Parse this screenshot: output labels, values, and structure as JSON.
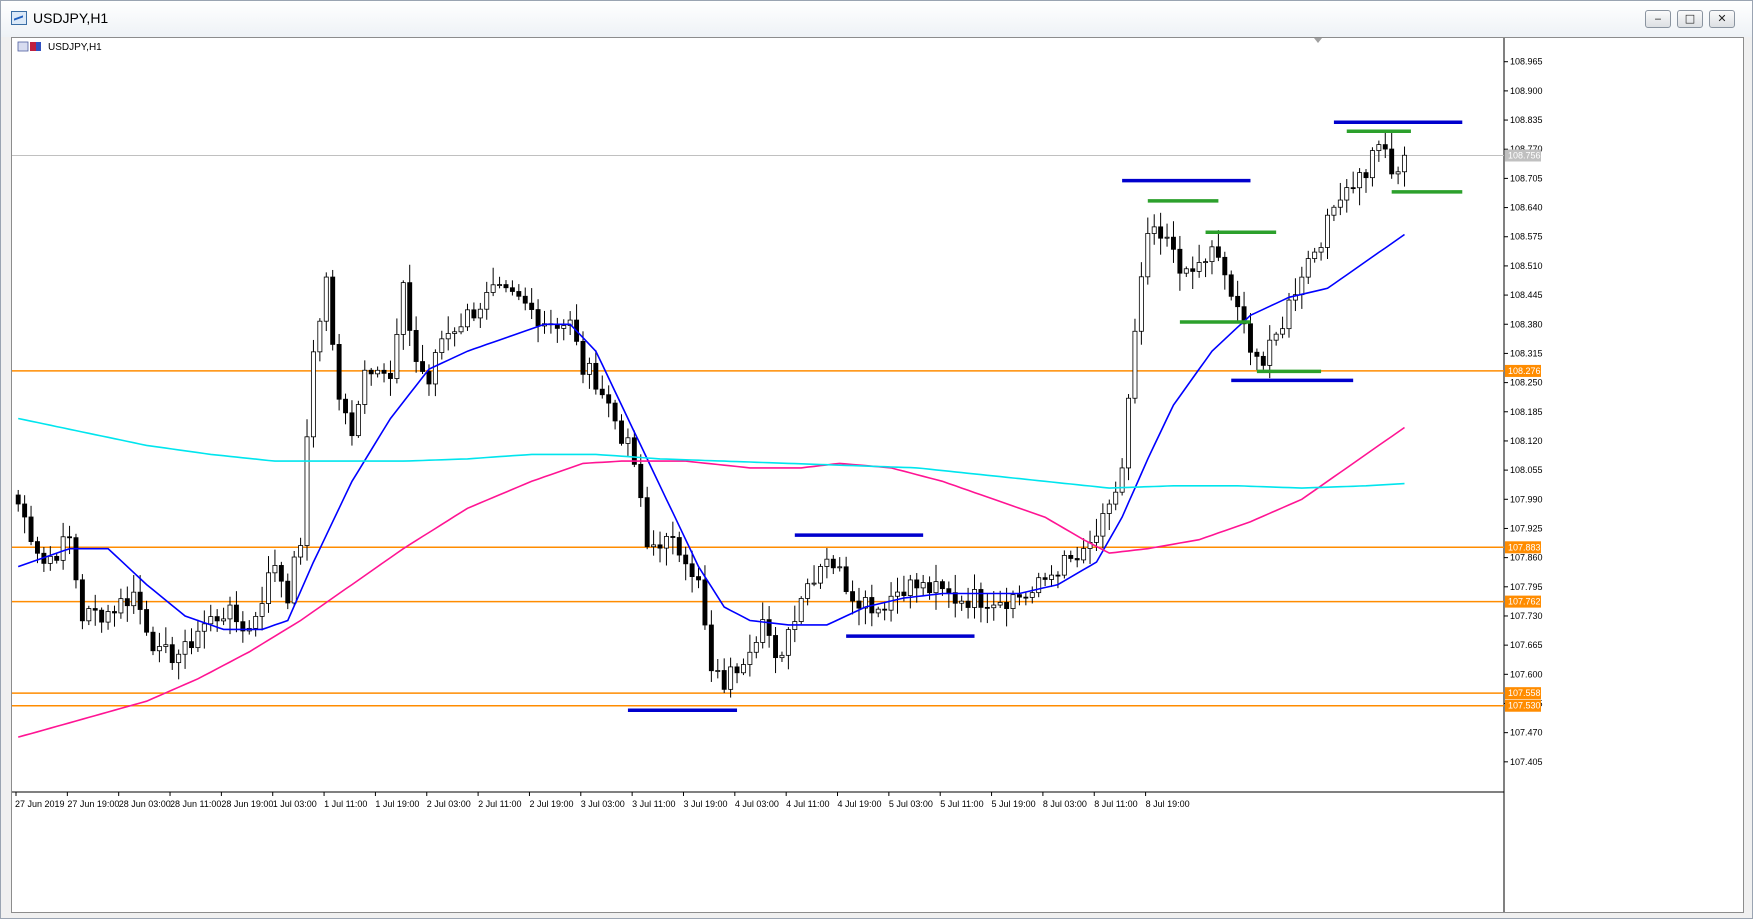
{
  "window": {
    "title": "USDJPY,H1",
    "min_label": "‒",
    "max_label": "□",
    "close_label": "✕"
  },
  "chart_label": "USDJPY,H1",
  "chart_data": {
    "type": "candlestick",
    "symbol": "USDJPY",
    "timeframe": "H1",
    "ylim": [
      107.34,
      109.0
    ],
    "y_ticks": [
      "108.965",
      "108.900",
      "108.835",
      "108.770",
      "108.705",
      "108.640",
      "108.575",
      "108.510",
      "108.445",
      "108.380",
      "108.315",
      "108.250",
      "108.185",
      "108.120",
      "108.055",
      "107.990",
      "107.925",
      "107.860",
      "107.795",
      "107.730",
      "107.665",
      "107.600",
      "107.535",
      "107.470",
      "107.405"
    ],
    "x_ticks": [
      "27 Jun 2019",
      "27 Jun 19:00",
      "28 Jun 03:00",
      "28 Jun 11:00",
      "28 Jun 19:00",
      "1 Jul 03:00",
      "1 Jul 11:00",
      "1 Jul 19:00",
      "2 Jul 03:00",
      "2 Jul 11:00",
      "2 Jul 19:00",
      "3 Jul 03:00",
      "3 Jul 11:00",
      "3 Jul 19:00",
      "4 Jul 03:00",
      "4 Jul 11:00",
      "4 Jul 19:00",
      "5 Jul 03:00",
      "5 Jul 11:00",
      "5 Jul 19:00",
      "8 Jul 03:00",
      "8 Jul 11:00",
      "8 Jul 19:00"
    ],
    "current_price": {
      "label": "108.756",
      "value": 108.756,
      "color": "#c0c0c0"
    },
    "horizontal_levels": [
      {
        "label": "108.276",
        "value": 108.276,
        "color": "#ff8c00"
      },
      {
        "label": "107.883",
        "value": 107.883,
        "color": "#ff8c00"
      },
      {
        "label": "107.762",
        "value": 107.762,
        "color": "#ff8c00"
      },
      {
        "label": "107.558",
        "value": 107.558,
        "color": "#ff8c00"
      },
      {
        "label": "107.530",
        "value": 107.53,
        "color": "#ff8c00"
      }
    ],
    "segments": [
      {
        "color": "#0000cd",
        "start_bar": 95,
        "end_bar": 112,
        "price": 107.52
      },
      {
        "color": "#0000cd",
        "start_bar": 121,
        "end_bar": 141,
        "price": 107.91
      },
      {
        "color": "#0000cd",
        "start_bar": 129,
        "end_bar": 149,
        "price": 107.685
      },
      {
        "color": "#0000cd",
        "start_bar": 172,
        "end_bar": 192,
        "price": 108.7
      },
      {
        "color": "#2ca02c",
        "start_bar": 176,
        "end_bar": 187,
        "price": 108.655
      },
      {
        "color": "#2ca02c",
        "start_bar": 185,
        "end_bar": 196,
        "price": 108.585
      },
      {
        "color": "#2ca02c",
        "start_bar": 181,
        "end_bar": 192,
        "price": 108.385
      },
      {
        "color": "#0000cd",
        "start_bar": 189,
        "end_bar": 208,
        "price": 108.255
      },
      {
        "color": "#2ca02c",
        "start_bar": 193,
        "end_bar": 203,
        "price": 108.275
      },
      {
        "color": "#0000cd",
        "start_bar": 205,
        "end_bar": 225,
        "price": 108.83
      },
      {
        "color": "#2ca02c",
        "start_bar": 207,
        "end_bar": 217,
        "price": 108.81
      },
      {
        "color": "#2ca02c",
        "start_bar": 214,
        "end_bar": 225,
        "price": 108.675
      }
    ],
    "moving_averages": [
      {
        "color": "#0000ff",
        "keys": [
          [
            0,
            107.84
          ],
          [
            8,
            107.88
          ],
          [
            14,
            107.88
          ],
          [
            20,
            107.8
          ],
          [
            26,
            107.73
          ],
          [
            32,
            107.7
          ],
          [
            38,
            107.7
          ],
          [
            42,
            107.72
          ],
          [
            46,
            107.85
          ],
          [
            52,
            108.03
          ],
          [
            58,
            108.17
          ],
          [
            64,
            108.28
          ],
          [
            70,
            108.32
          ],
          [
            76,
            108.35
          ],
          [
            82,
            108.38
          ],
          [
            86,
            108.38
          ],
          [
            90,
            108.32
          ],
          [
            94,
            108.2
          ],
          [
            98,
            108.08
          ],
          [
            102,
            107.96
          ],
          [
            106,
            107.84
          ],
          [
            110,
            107.75
          ],
          [
            114,
            107.72
          ],
          [
            120,
            107.71
          ],
          [
            126,
            107.71
          ],
          [
            132,
            107.75
          ],
          [
            138,
            107.77
          ],
          [
            144,
            107.78
          ],
          [
            150,
            107.78
          ],
          [
            156,
            107.78
          ],
          [
            162,
            107.8
          ],
          [
            168,
            107.85
          ],
          [
            172,
            107.95
          ],
          [
            176,
            108.08
          ],
          [
            180,
            108.2
          ],
          [
            186,
            108.32
          ],
          [
            192,
            108.4
          ],
          [
            198,
            108.44
          ],
          [
            204,
            108.46
          ],
          [
            210,
            108.52
          ],
          [
            216,
            108.58
          ]
        ]
      },
      {
        "color": "#ff1493",
        "keys": [
          [
            0,
            107.46
          ],
          [
            10,
            107.5
          ],
          [
            20,
            107.54
          ],
          [
            28,
            107.59
          ],
          [
            36,
            107.65
          ],
          [
            44,
            107.72
          ],
          [
            52,
            107.8
          ],
          [
            60,
            107.88
          ],
          [
            70,
            107.97
          ],
          [
            80,
            108.03
          ],
          [
            88,
            108.07
          ],
          [
            94,
            108.075
          ],
          [
            104,
            108.075
          ],
          [
            114,
            108.06
          ],
          [
            122,
            108.06
          ],
          [
            128,
            108.07
          ],
          [
            136,
            108.06
          ],
          [
            144,
            108.03
          ],
          [
            152,
            107.99
          ],
          [
            160,
            107.95
          ],
          [
            166,
            107.9
          ],
          [
            170,
            107.87
          ],
          [
            176,
            107.88
          ],
          [
            184,
            107.9
          ],
          [
            192,
            107.94
          ],
          [
            200,
            107.99
          ],
          [
            206,
            108.05
          ],
          [
            212,
            108.11
          ],
          [
            216,
            108.15
          ]
        ]
      },
      {
        "color": "#00e5ee",
        "keys": [
          [
            0,
            108.17
          ],
          [
            10,
            108.14
          ],
          [
            20,
            108.11
          ],
          [
            30,
            108.09
          ],
          [
            40,
            108.075
          ],
          [
            50,
            108.075
          ],
          [
            60,
            108.075
          ],
          [
            70,
            108.08
          ],
          [
            80,
            108.09
          ],
          [
            90,
            108.09
          ],
          [
            100,
            108.08
          ],
          [
            110,
            108.075
          ],
          [
            120,
            108.07
          ],
          [
            130,
            108.065
          ],
          [
            140,
            108.06
          ],
          [
            150,
            108.045
          ],
          [
            160,
            108.03
          ],
          [
            170,
            108.015
          ],
          [
            180,
            108.02
          ],
          [
            190,
            108.02
          ],
          [
            200,
            108.015
          ],
          [
            210,
            108.02
          ],
          [
            216,
            108.025
          ]
        ]
      }
    ],
    "price_anchors": [
      [
        0,
        107.98
      ],
      [
        4,
        107.85
      ],
      [
        8,
        107.9
      ],
      [
        10,
        107.73
      ],
      [
        14,
        107.74
      ],
      [
        18,
        107.78
      ],
      [
        22,
        107.64
      ],
      [
        26,
        107.65
      ],
      [
        28,
        107.7
      ],
      [
        32,
        107.74
      ],
      [
        36,
        107.7
      ],
      [
        40,
        107.85
      ],
      [
        42,
        107.78
      ],
      [
        44,
        107.9
      ],
      [
        46,
        108.32
      ],
      [
        48,
        108.48
      ],
      [
        50,
        108.2
      ],
      [
        52,
        108.15
      ],
      [
        54,
        108.28
      ],
      [
        56,
        108.3
      ],
      [
        58,
        108.25
      ],
      [
        60,
        108.45
      ],
      [
        62,
        108.3
      ],
      [
        64,
        108.25
      ],
      [
        66,
        108.35
      ],
      [
        70,
        108.4
      ],
      [
        74,
        108.45
      ],
      [
        78,
        108.43
      ],
      [
        82,
        108.39
      ],
      [
        86,
        108.38
      ],
      [
        88,
        108.28
      ],
      [
        90,
        108.26
      ],
      [
        92,
        108.2
      ],
      [
        96,
        108.07
      ],
      [
        98,
        107.88
      ],
      [
        100,
        107.9
      ],
      [
        104,
        107.87
      ],
      [
        106,
        107.8
      ],
      [
        108,
        107.6
      ],
      [
        110,
        107.58
      ],
      [
        112,
        107.62
      ],
      [
        116,
        107.72
      ],
      [
        118,
        107.62
      ],
      [
        122,
        107.78
      ],
      [
        126,
        107.87
      ],
      [
        130,
        107.78
      ],
      [
        134,
        107.75
      ],
      [
        138,
        107.8
      ],
      [
        142,
        107.79
      ],
      [
        146,
        107.77
      ],
      [
        150,
        107.77
      ],
      [
        154,
        107.77
      ],
      [
        158,
        107.78
      ],
      [
        162,
        107.84
      ],
      [
        166,
        107.86
      ],
      [
        170,
        107.96
      ],
      [
        172,
        108.06
      ],
      [
        174,
        108.35
      ],
      [
        176,
        108.58
      ],
      [
        180,
        108.55
      ],
      [
        182,
        108.48
      ],
      [
        186,
        108.54
      ],
      [
        188,
        108.49
      ],
      [
        190,
        108.4
      ],
      [
        192,
        108.34
      ],
      [
        194,
        108.29
      ],
      [
        196,
        108.35
      ],
      [
        200,
        108.5
      ],
      [
        204,
        108.6
      ],
      [
        206,
        108.68
      ],
      [
        210,
        108.72
      ],
      [
        212,
        108.79
      ],
      [
        214,
        108.71
      ],
      [
        216,
        108.74
      ]
    ],
    "bar_count": 217
  }
}
